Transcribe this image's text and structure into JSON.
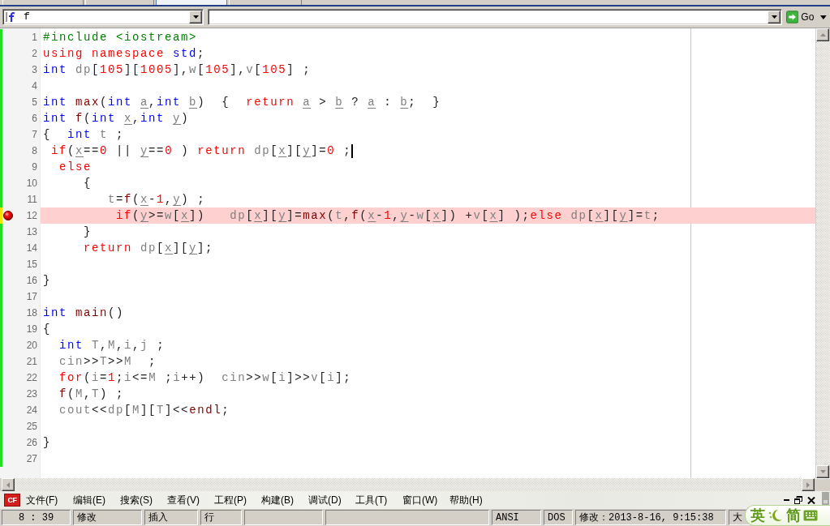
{
  "tabs": [
    {
      "selected": false
    },
    {
      "selected": false
    },
    {
      "selected": true
    },
    {
      "selected": false
    }
  ],
  "toolbar": {
    "function_selector": {
      "value": "f"
    },
    "go_button": {
      "label": "Go"
    }
  },
  "editor": {
    "lines": [
      {
        "number": "1",
        "breakpoint": false,
        "cursor": false,
        "unsaved": false,
        "tokens": [
          {
            "kind": "preprocessor",
            "text": "#include <iostream>"
          }
        ]
      },
      {
        "number": "2",
        "breakpoint": false,
        "cursor": false,
        "unsaved": false,
        "tokens": [
          {
            "kind": "keyword",
            "text": "using namespace "
          },
          {
            "kind": "type",
            "text": "std"
          },
          {
            "kind": "plain",
            "text": ";"
          }
        ]
      },
      {
        "number": "3",
        "breakpoint": false,
        "cursor": false,
        "unsaved": false,
        "tokens": [
          {
            "kind": "type",
            "text": "int "
          },
          {
            "kind": "identifier",
            "text": "dp"
          },
          {
            "kind": "plain",
            "text": "["
          },
          {
            "kind": "number",
            "text": "105"
          },
          {
            "kind": "plain",
            "text": "]["
          },
          {
            "kind": "number",
            "text": "1005"
          },
          {
            "kind": "plain",
            "text": "],"
          },
          {
            "kind": "identifier",
            "text": "w"
          },
          {
            "kind": "plain",
            "text": "["
          },
          {
            "kind": "number",
            "text": "105"
          },
          {
            "kind": "plain",
            "text": "],"
          },
          {
            "kind": "identifier",
            "text": "v"
          },
          {
            "kind": "plain",
            "text": "["
          },
          {
            "kind": "number",
            "text": "105"
          },
          {
            "kind": "plain",
            "text": "] ;"
          }
        ]
      },
      {
        "number": "4",
        "breakpoint": false,
        "cursor": false,
        "unsaved": false
      },
      {
        "number": "5",
        "breakpoint": false,
        "cursor": false,
        "unsaved": false,
        "tokens": [
          {
            "kind": "type",
            "text": "int "
          },
          {
            "kind": "function",
            "text": "max"
          },
          {
            "kind": "plain",
            "text": "("
          },
          {
            "kind": "type",
            "text": "int "
          },
          {
            "kind": "param",
            "text": "a"
          },
          {
            "kind": "plain",
            "text": ","
          },
          {
            "kind": "type",
            "text": "int "
          },
          {
            "kind": "param",
            "text": "b"
          },
          {
            "kind": "plain",
            "text": ")  {  "
          },
          {
            "kind": "keyword",
            "text": "return "
          },
          {
            "kind": "param",
            "text": "a"
          },
          {
            "kind": "plain",
            "text": " > "
          },
          {
            "kind": "param",
            "text": "b"
          },
          {
            "kind": "plain",
            "text": " ? "
          },
          {
            "kind": "param",
            "text": "a"
          },
          {
            "kind": "plain",
            "text": " : "
          },
          {
            "kind": "param",
            "text": "b"
          },
          {
            "kind": "plain",
            "text": ";  }"
          }
        ]
      },
      {
        "number": "6",
        "breakpoint": false,
        "cursor": false,
        "unsaved": false,
        "tokens": [
          {
            "kind": "type",
            "text": "int "
          },
          {
            "kind": "function",
            "text": "f"
          },
          {
            "kind": "plain",
            "text": "("
          },
          {
            "kind": "type",
            "text": "int "
          },
          {
            "kind": "param",
            "text": "x"
          },
          {
            "kind": "plain",
            "text": ","
          },
          {
            "kind": "type",
            "text": "int "
          },
          {
            "kind": "param",
            "text": "y"
          },
          {
            "kind": "plain",
            "text": ")"
          }
        ]
      },
      {
        "number": "7",
        "breakpoint": false,
        "cursor": false,
        "unsaved": false,
        "tokens": [
          {
            "kind": "plain",
            "text": "{  "
          },
          {
            "kind": "type",
            "text": "int "
          },
          {
            "kind": "identifier",
            "text": "t"
          },
          {
            "kind": "plain",
            "text": " ;"
          }
        ]
      },
      {
        "number": "8",
        "breakpoint": false,
        "cursor": true,
        "unsaved": false,
        "tokens": [
          {
            "kind": "keyword",
            "text": " if"
          },
          {
            "kind": "plain",
            "text": "("
          },
          {
            "kind": "param",
            "text": "x"
          },
          {
            "kind": "plain",
            "text": "=="
          },
          {
            "kind": "number",
            "text": "0"
          },
          {
            "kind": "plain",
            "text": " || "
          },
          {
            "kind": "param",
            "text": "y"
          },
          {
            "kind": "plain",
            "text": "=="
          },
          {
            "kind": "number",
            "text": "0"
          },
          {
            "kind": "plain",
            "text": " ) "
          },
          {
            "kind": "keyword",
            "text": "return "
          },
          {
            "kind": "identifier",
            "text": "dp"
          },
          {
            "kind": "plain",
            "text": "["
          },
          {
            "kind": "param",
            "text": "x"
          },
          {
            "kind": "plain",
            "text": "]["
          },
          {
            "kind": "param",
            "text": "y"
          },
          {
            "kind": "plain",
            "text": "]="
          },
          {
            "kind": "number",
            "text": "0"
          },
          {
            "kind": "plain",
            "text": " ;"
          }
        ]
      },
      {
        "number": "9",
        "breakpoint": false,
        "cursor": false,
        "unsaved": false,
        "tokens": [
          {
            "kind": "keyword",
            "text": "  else"
          }
        ]
      },
      {
        "number": "10",
        "breakpoint": false,
        "cursor": false,
        "unsaved": false,
        "tokens": [
          {
            "kind": "plain",
            "text": "     {"
          }
        ]
      },
      {
        "number": "11",
        "breakpoint": false,
        "cursor": false,
        "unsaved": false,
        "tokens": [
          {
            "kind": "identifier",
            "text": "        t"
          },
          {
            "kind": "plain",
            "text": "="
          },
          {
            "kind": "function",
            "text": "f"
          },
          {
            "kind": "plain",
            "text": "("
          },
          {
            "kind": "param",
            "text": "x"
          },
          {
            "kind": "plain",
            "text": "-"
          },
          {
            "kind": "number",
            "text": "1"
          },
          {
            "kind": "plain",
            "text": ","
          },
          {
            "kind": "param",
            "text": "y"
          },
          {
            "kind": "plain",
            "text": ") ;"
          }
        ]
      },
      {
        "number": "12",
        "breakpoint": true,
        "cursor": false,
        "unsaved": true,
        "tokens": [
          {
            "kind": "keyword",
            "text": "         if"
          },
          {
            "kind": "plain",
            "text": "("
          },
          {
            "kind": "param",
            "text": "y"
          },
          {
            "kind": "plain",
            "text": ">="
          },
          {
            "kind": "identifier",
            "text": "w"
          },
          {
            "kind": "plain",
            "text": "["
          },
          {
            "kind": "param",
            "text": "x"
          },
          {
            "kind": "plain",
            "text": "])   "
          },
          {
            "kind": "identifier",
            "text": "dp"
          },
          {
            "kind": "plain",
            "text": "["
          },
          {
            "kind": "param",
            "text": "x"
          },
          {
            "kind": "plain",
            "text": "]["
          },
          {
            "kind": "param",
            "text": "y"
          },
          {
            "kind": "plain",
            "text": "]="
          },
          {
            "kind": "function",
            "text": "max"
          },
          {
            "kind": "plain",
            "text": "("
          },
          {
            "kind": "identifier",
            "text": "t"
          },
          {
            "kind": "plain",
            "text": ","
          },
          {
            "kind": "function",
            "text": "f"
          },
          {
            "kind": "plain",
            "text": "("
          },
          {
            "kind": "param",
            "text": "x"
          },
          {
            "kind": "plain",
            "text": "-"
          },
          {
            "kind": "number",
            "text": "1"
          },
          {
            "kind": "plain",
            "text": ","
          },
          {
            "kind": "param",
            "text": "y"
          },
          {
            "kind": "plain",
            "text": "-"
          },
          {
            "kind": "identifier",
            "text": "w"
          },
          {
            "kind": "plain",
            "text": "["
          },
          {
            "kind": "param",
            "text": "x"
          },
          {
            "kind": "plain",
            "text": "]) +"
          },
          {
            "kind": "identifier",
            "text": "v"
          },
          {
            "kind": "plain",
            "text": "["
          },
          {
            "kind": "param",
            "text": "x"
          },
          {
            "kind": "plain",
            "text": "] );"
          },
          {
            "kind": "keyword",
            "text": "else "
          },
          {
            "kind": "identifier",
            "text": "dp"
          },
          {
            "kind": "plain",
            "text": "["
          },
          {
            "kind": "param",
            "text": "x"
          },
          {
            "kind": "plain",
            "text": "]["
          },
          {
            "kind": "param",
            "text": "y"
          },
          {
            "kind": "plain",
            "text": "]="
          },
          {
            "kind": "identifier",
            "text": "t"
          },
          {
            "kind": "plain",
            "text": ";"
          }
        ]
      },
      {
        "number": "13",
        "breakpoint": false,
        "cursor": false,
        "unsaved": false,
        "tokens": [
          {
            "kind": "plain",
            "text": "     }"
          }
        ]
      },
      {
        "number": "14",
        "breakpoint": false,
        "cursor": false,
        "unsaved": false,
        "tokens": [
          {
            "kind": "keyword",
            "text": "     return "
          },
          {
            "kind": "identifier",
            "text": "dp"
          },
          {
            "kind": "plain",
            "text": "["
          },
          {
            "kind": "param",
            "text": "x"
          },
          {
            "kind": "plain",
            "text": "]["
          },
          {
            "kind": "param",
            "text": "y"
          },
          {
            "kind": "plain",
            "text": "];"
          }
        ]
      },
      {
        "number": "15",
        "breakpoint": false,
        "cursor": false,
        "unsaved": false
      },
      {
        "number": "16",
        "breakpoint": false,
        "cursor": false,
        "unsaved": false,
        "tokens": [
          {
            "kind": "plain",
            "text": "}"
          }
        ]
      },
      {
        "number": "17",
        "breakpoint": false,
        "cursor": false,
        "unsaved": false
      },
      {
        "number": "18",
        "breakpoint": false,
        "cursor": false,
        "unsaved": false,
        "tokens": [
          {
            "kind": "type",
            "text": "int "
          },
          {
            "kind": "function",
            "text": "main"
          },
          {
            "kind": "plain",
            "text": "()"
          }
        ]
      },
      {
        "number": "19",
        "breakpoint": false,
        "cursor": false,
        "unsaved": false,
        "tokens": [
          {
            "kind": "plain",
            "text": "{"
          }
        ]
      },
      {
        "number": "20",
        "breakpoint": false,
        "cursor": false,
        "unsaved": false,
        "tokens": [
          {
            "kind": "type",
            "text": "  int "
          },
          {
            "kind": "identifier",
            "text": "T"
          },
          {
            "kind": "plain",
            "text": ","
          },
          {
            "kind": "identifier",
            "text": "M"
          },
          {
            "kind": "plain",
            "text": ","
          },
          {
            "kind": "identifier",
            "text": "i"
          },
          {
            "kind": "plain",
            "text": ","
          },
          {
            "kind": "identifier",
            "text": "j"
          },
          {
            "kind": "plain",
            "text": " ;"
          }
        ]
      },
      {
        "number": "21",
        "breakpoint": false,
        "cursor": false,
        "unsaved": false,
        "tokens": [
          {
            "kind": "identifier",
            "text": "  cin"
          },
          {
            "kind": "plain",
            "text": ">>"
          },
          {
            "kind": "identifier",
            "text": "T"
          },
          {
            "kind": "plain",
            "text": ">>"
          },
          {
            "kind": "identifier",
            "text": "M"
          },
          {
            "kind": "plain",
            "text": "  ;"
          }
        ]
      },
      {
        "number": "22",
        "breakpoint": false,
        "cursor": false,
        "unsaved": false,
        "tokens": [
          {
            "kind": "keyword",
            "text": "  for"
          },
          {
            "kind": "plain",
            "text": "("
          },
          {
            "kind": "identifier",
            "text": "i"
          },
          {
            "kind": "plain",
            "text": "="
          },
          {
            "kind": "number",
            "text": "1"
          },
          {
            "kind": "plain",
            "text": ";"
          },
          {
            "kind": "identifier",
            "text": "i"
          },
          {
            "kind": "plain",
            "text": "<="
          },
          {
            "kind": "identifier",
            "text": "M"
          },
          {
            "kind": "plain",
            "text": " ;"
          },
          {
            "kind": "identifier",
            "text": "i"
          },
          {
            "kind": "plain",
            "text": "++)  "
          },
          {
            "kind": "identifier",
            "text": "cin"
          },
          {
            "kind": "plain",
            "text": ">>"
          },
          {
            "kind": "identifier",
            "text": "w"
          },
          {
            "kind": "plain",
            "text": "["
          },
          {
            "kind": "identifier",
            "text": "i"
          },
          {
            "kind": "plain",
            "text": "]>>"
          },
          {
            "kind": "identifier",
            "text": "v"
          },
          {
            "kind": "plain",
            "text": "["
          },
          {
            "kind": "identifier",
            "text": "i"
          },
          {
            "kind": "plain",
            "text": "];"
          }
        ]
      },
      {
        "number": "23",
        "breakpoint": false,
        "cursor": false,
        "unsaved": false,
        "tokens": [
          {
            "kind": "function",
            "text": "  f"
          },
          {
            "kind": "plain",
            "text": "("
          },
          {
            "kind": "identifier",
            "text": "M"
          },
          {
            "kind": "plain",
            "text": ","
          },
          {
            "kind": "identifier",
            "text": "T"
          },
          {
            "kind": "plain",
            "text": ") ;"
          }
        ]
      },
      {
        "number": "24",
        "breakpoint": false,
        "cursor": false,
        "unsaved": false,
        "tokens": [
          {
            "kind": "identifier",
            "text": "  cout"
          },
          {
            "kind": "plain",
            "text": "<<"
          },
          {
            "kind": "identifier",
            "text": "dp"
          },
          {
            "kind": "plain",
            "text": "["
          },
          {
            "kind": "identifier",
            "text": "M"
          },
          {
            "kind": "plain",
            "text": "]["
          },
          {
            "kind": "identifier",
            "text": "T"
          },
          {
            "kind": "plain",
            "text": "]<<"
          },
          {
            "kind": "function",
            "text": "endl"
          },
          {
            "kind": "plain",
            "text": ";"
          }
        ]
      },
      {
        "number": "25",
        "breakpoint": false,
        "cursor": false,
        "unsaved": false
      },
      {
        "number": "26",
        "breakpoint": false,
        "cursor": false,
        "unsaved": false,
        "tokens": [
          {
            "kind": "plain",
            "text": "}"
          }
        ]
      },
      {
        "number": "27",
        "breakpoint": false,
        "cursor": false,
        "unsaved": false
      }
    ]
  },
  "menu_bar": {
    "logo": "CF",
    "items": [
      "文件(F)",
      "编辑(E)",
      "搜索(S)",
      "查看(V)",
      "工程(P)",
      "构建(B)",
      "调试(D)",
      "工具(T)",
      "窗口(W)",
      "帮助(H)"
    ]
  },
  "status_bar": {
    "panes": [
      {
        "kind": "text",
        "text": "8 : 39"
      },
      {
        "kind": "text",
        "text": "修改"
      },
      {
        "kind": "text",
        "text": "插入"
      },
      {
        "kind": "text",
        "text": "行"
      },
      {
        "kind": "blank"
      },
      {
        "kind": "blank"
      },
      {
        "kind": "text",
        "text": "ANSI"
      },
      {
        "kind": "text",
        "text": "DOS"
      },
      {
        "kind": "text",
        "text": "修改：2013-8-16, 9:15:38"
      },
      {
        "kind": "text",
        "text": "大"
      }
    ]
  },
  "ime_toolbar": {
    "mode": "英",
    "script": "简"
  }
}
